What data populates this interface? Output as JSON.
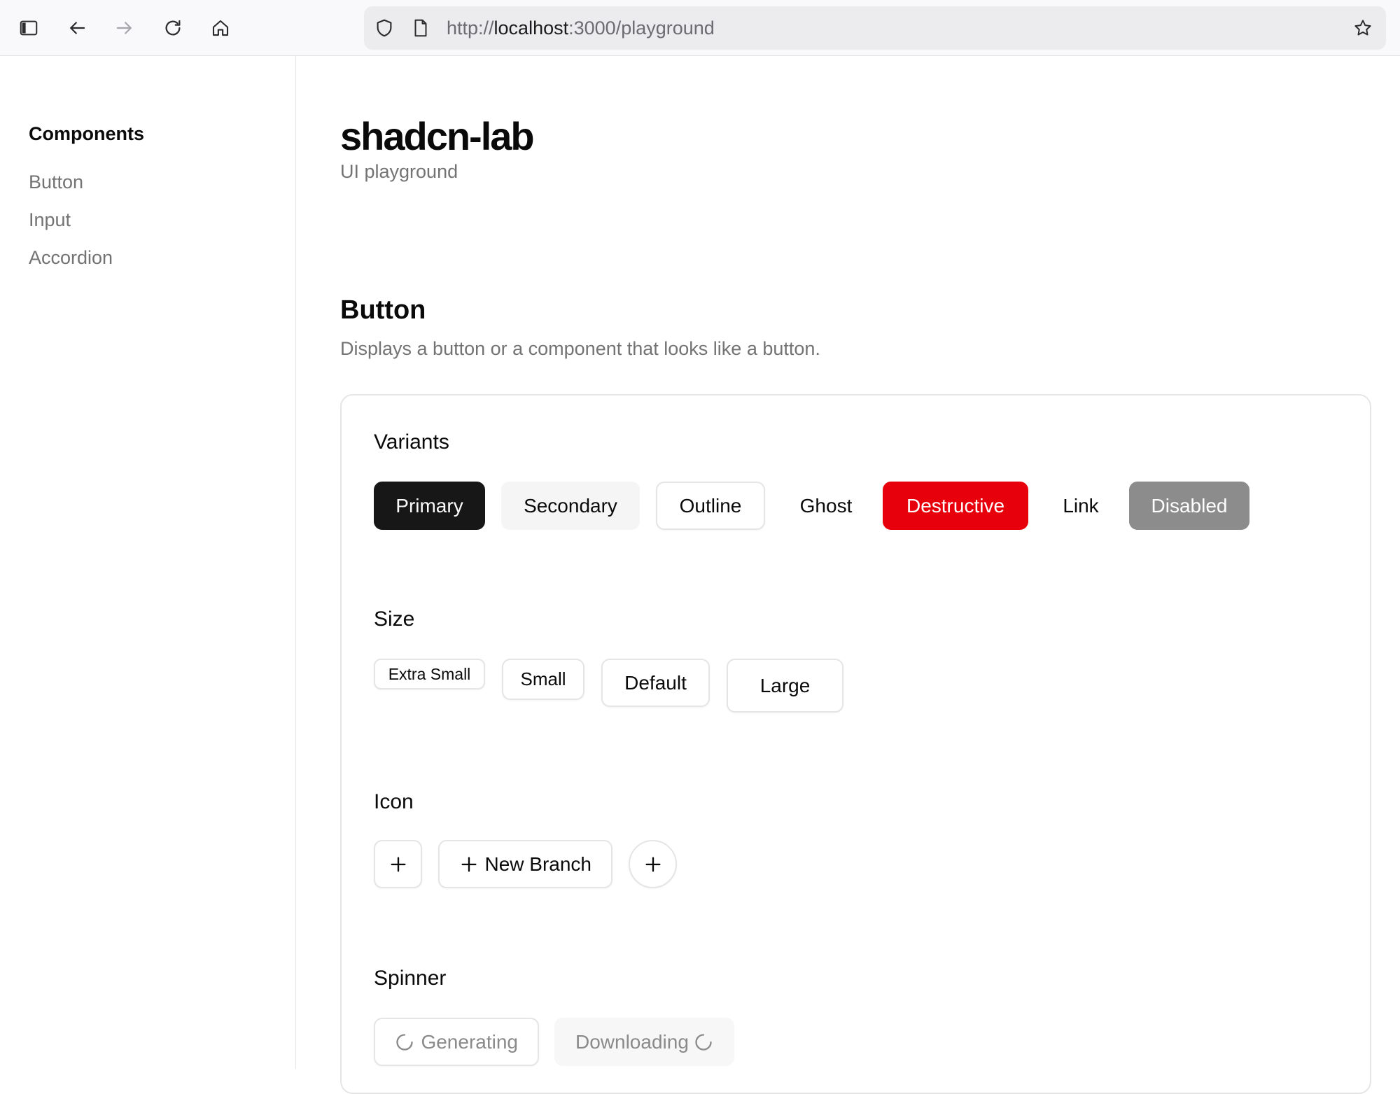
{
  "browser": {
    "url_prefix": "http://",
    "url_host": "localhost",
    "url_path": ":3000/playground",
    "icons": {
      "sidebar": "sidebar-toggle-icon",
      "back": "back-arrow-icon",
      "forward": "forward-arrow-icon",
      "reload": "reload-icon",
      "home": "home-icon",
      "shield": "shield-icon",
      "page": "page-icon",
      "bookmark": "star-icon"
    }
  },
  "sidebar": {
    "title": "Components",
    "items": [
      {
        "label": "Button"
      },
      {
        "label": "Input"
      },
      {
        "label": "Accordion"
      }
    ]
  },
  "header": {
    "title": "shadcn-lab",
    "subtitle": "UI playground"
  },
  "section": {
    "title": "Button",
    "description": "Displays a button or a component that looks like a button."
  },
  "groups": {
    "variants": {
      "title": "Variants",
      "buttons": [
        "Primary",
        "Secondary",
        "Outline",
        "Ghost",
        "Destructive",
        "Link",
        "Disabled"
      ]
    },
    "size": {
      "title": "Size",
      "buttons": [
        "Extra Small",
        "Small",
        "Default",
        "Large"
      ]
    },
    "icon": {
      "title": "Icon",
      "new_branch": "New Branch",
      "icon_name": "plus-icon"
    },
    "spinner": {
      "title": "Spinner",
      "buttons": [
        "Generating",
        "Downloading"
      ],
      "icon_name": "spinner-icon"
    }
  },
  "colors": {
    "primary": "#171717",
    "destructive": "#e7000b",
    "disabled": "#8c8c8c",
    "muted_text": "#737373",
    "border": "#e5e5e5"
  }
}
